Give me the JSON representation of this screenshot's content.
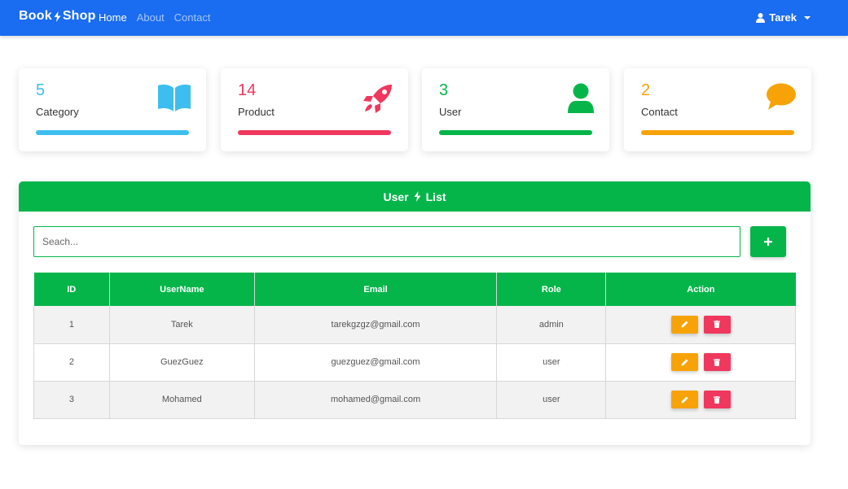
{
  "navbar": {
    "brand_left": "Book",
    "brand_right": "Shop",
    "links": [
      {
        "label": "Home",
        "active": true
      },
      {
        "label": "About",
        "active": false
      },
      {
        "label": "Contact",
        "active": false
      }
    ],
    "user": "Tarek"
  },
  "stats": [
    {
      "count": "5",
      "label": "Category",
      "color": "#3dbeee",
      "icon": "book-icon"
    },
    {
      "count": "14",
      "label": "Product",
      "color": "#f0375d",
      "icon": "rocket-icon"
    },
    {
      "count": "3",
      "label": "User",
      "color": "#05b54a",
      "icon": "user-icon"
    },
    {
      "count": "2",
      "label": "Contact",
      "color": "#f7a307",
      "icon": "chat-icon"
    }
  ],
  "panel": {
    "title_left": "User",
    "title_right": "List",
    "search_placeholder": "Seach...",
    "columns": [
      "ID",
      "UserName",
      "Email",
      "Role",
      "Action"
    ],
    "rows": [
      {
        "id": "1",
        "username": "Tarek",
        "email": "tarekgzgz@gmail.com",
        "role": "admin"
      },
      {
        "id": "2",
        "username": "GuezGuez",
        "email": "guezguez@gmail.com",
        "role": "user"
      },
      {
        "id": "3",
        "username": "Mohamed",
        "email": "mohamed@gmail.com",
        "role": "user"
      }
    ]
  },
  "colors": {
    "navbar": "#1a6cf0",
    "accent_green": "#05b54a",
    "edit": "#f7a307",
    "delete": "#f0375d"
  }
}
